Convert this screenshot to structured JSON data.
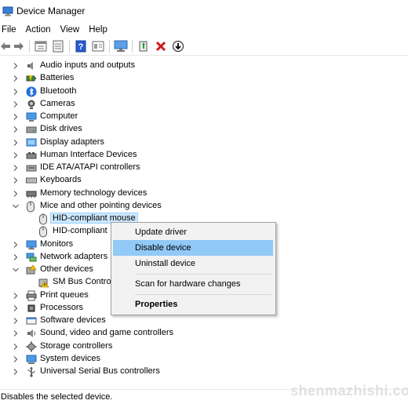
{
  "window": {
    "title": "Device Manager"
  },
  "menu": [
    "File",
    "Action",
    "View",
    "Help"
  ],
  "toolbar": {
    "buttons": [
      "back-icon",
      "forward-icon",
      "properties-icon",
      "show-hide-icon",
      "help-icon",
      "view-icon",
      "monitor-icon",
      "update-driver-icon",
      "uninstall-icon",
      "disable-icon"
    ]
  },
  "tree": {
    "categories": [
      {
        "label": "Audio inputs and outputs",
        "icon": "speaker-icon"
      },
      {
        "label": "Batteries",
        "icon": "battery-icon"
      },
      {
        "label": "Bluetooth",
        "icon": "bluetooth-icon"
      },
      {
        "label": "Cameras",
        "icon": "camera-icon"
      },
      {
        "label": "Computer",
        "icon": "computer-icon"
      },
      {
        "label": "Disk drives",
        "icon": "disk-icon"
      },
      {
        "label": "Display adapters",
        "icon": "display-adapter-icon"
      },
      {
        "label": "Human Interface Devices",
        "icon": "hid-icon"
      },
      {
        "label": "IDE ATA/ATAPI controllers",
        "icon": "ide-icon"
      },
      {
        "label": "Keyboards",
        "icon": "keyboard-icon"
      },
      {
        "label": "Memory technology devices",
        "icon": "memory-icon"
      },
      {
        "label": "Mice and other pointing devices",
        "icon": "mouse-icon",
        "expanded": true
      },
      {
        "label": "HID-compliant mouse",
        "icon": "mouse-icon",
        "child": true,
        "selected": true
      },
      {
        "label": "HID-compliant",
        "icon": "mouse-icon",
        "child": true
      },
      {
        "label": "Monitors",
        "icon": "monitor-icon"
      },
      {
        "label": "Network adapters",
        "icon": "network-icon"
      },
      {
        "label": "Other devices",
        "icon": "other-devices-icon",
        "expanded": true
      },
      {
        "label": "SM Bus Contro",
        "icon": "warning-device-icon",
        "child": true
      },
      {
        "label": "Print queues",
        "icon": "printer-icon"
      },
      {
        "label": "Processors",
        "icon": "processor-icon"
      },
      {
        "label": "Software devices",
        "icon": "software-icon"
      },
      {
        "label": "Sound, video and game controllers",
        "icon": "sound-icon"
      },
      {
        "label": "Storage controllers",
        "icon": "storage-icon"
      },
      {
        "label": "System devices",
        "icon": "system-icon"
      },
      {
        "label": "Universal Serial Bus controllers",
        "icon": "usb-icon"
      }
    ]
  },
  "context_menu": {
    "items": [
      {
        "label": "Update driver"
      },
      {
        "label": "Disable device",
        "highlighted": true
      },
      {
        "label": "Uninstall device"
      },
      {
        "label": "Scan for hardware changes"
      },
      {
        "label": "Properties",
        "bold": true
      }
    ]
  },
  "status": {
    "text": "Disables the selected device."
  },
  "watermark": "shenmazhishi.com",
  "colors": {
    "selection": "#cce8ff",
    "menu_highlight": "#91c9f7",
    "accent": "#0078d7"
  }
}
